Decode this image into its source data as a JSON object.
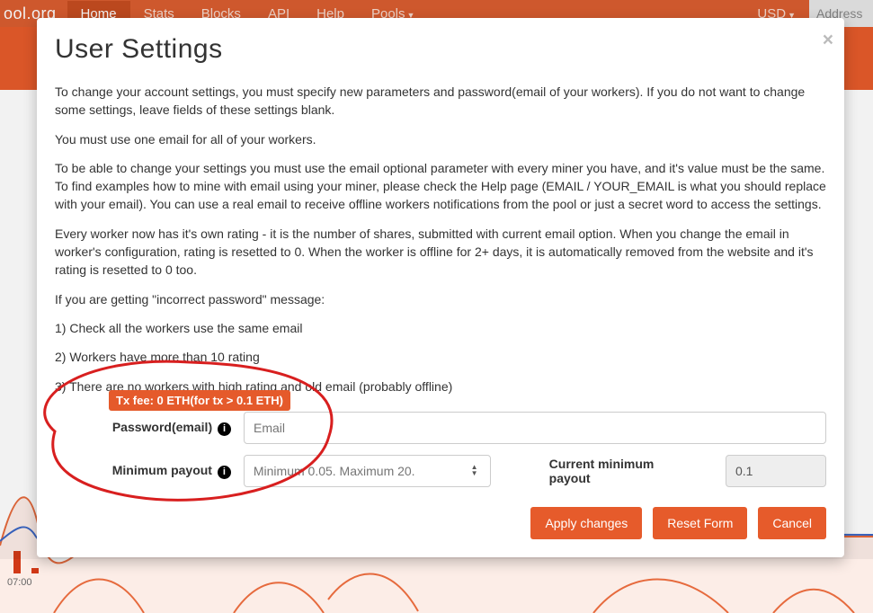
{
  "brand_text": "ool.org",
  "nav": {
    "home": "Home",
    "stats": "Stats",
    "blocks": "Blocks",
    "api": "API",
    "help": "Help",
    "pools": "Pools",
    "currency": "USD"
  },
  "address_placeholder": "Address",
  "time_label_0700": "07:00",
  "modal": {
    "title": "User Settings",
    "p1": "To change your account settings, you must specify new parameters and password(email of your workers). If you do not want to change some settings, leave fields of these settings blank.",
    "p2": "You must use one email for all of your workers.",
    "p3": "To be able to change your settings you must use the email optional parameter with every miner you have, and it's value must be the same. To find examples how to mine with email using your miner, please check the Help page (EMAIL / YOUR_EMAIL is what you should replace with your email). You can use a real email to receive offline workers notifications from the pool or just a secret word to access the settings.",
    "p4": "Every worker now has it's own rating - it is the number of shares, submitted with current email option. When you change the email in worker's configuration, rating is resetted to 0. When the worker is offline for 2+ days, it is automatically removed from the website and it's rating is resetted to 0 too.",
    "p5": "If you are getting \"incorrect password\" message:",
    "p6": "1) Check all the workers use the same email",
    "p7": "2) Workers have more than 10 rating",
    "p8": "3) There are no workers with high rating and old email (probably offline)"
  },
  "form": {
    "password_label": "Password(email)",
    "password_placeholder": "Email",
    "minpayout_label": "Minimum payout",
    "minpayout_placeholder": "Minimum 0.05. Maximum 20.",
    "current_label": "Current minimum payout",
    "current_value": "0.1",
    "tooltip": "Tx fee: 0 ETH(for tx > 0.1 ETH)"
  },
  "buttons": {
    "apply": "Apply changes",
    "reset": "Reset Form",
    "cancel": "Cancel"
  }
}
